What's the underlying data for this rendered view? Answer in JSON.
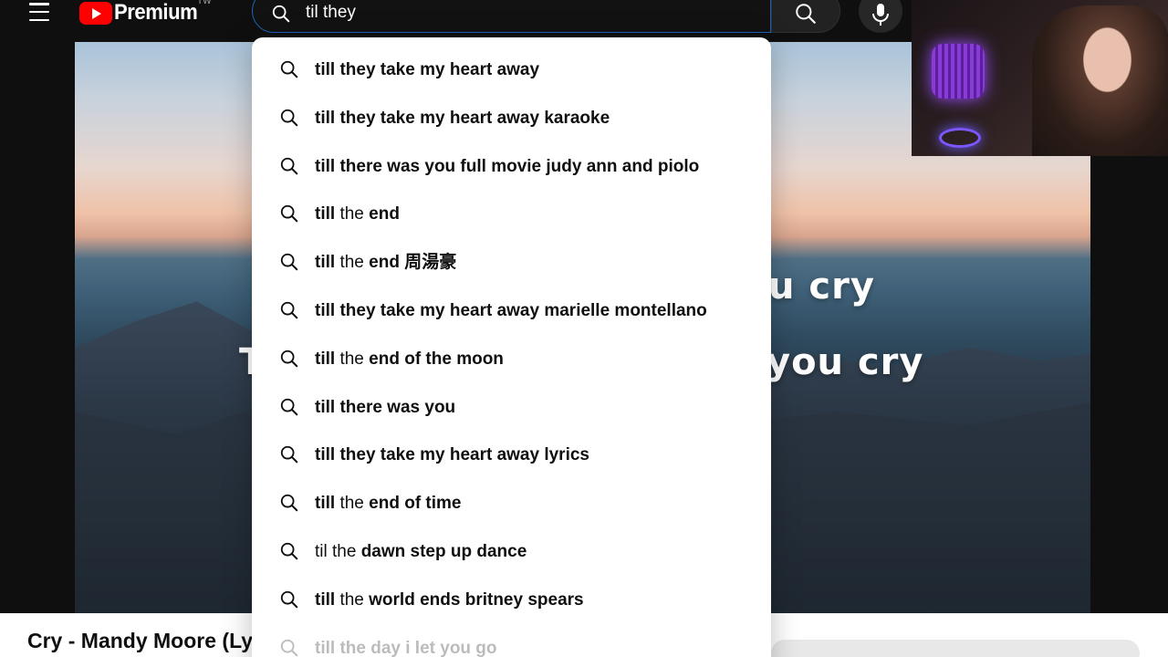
{
  "header": {
    "logo_text": "Premium",
    "country_code": "TW",
    "search_value": "til they"
  },
  "player": {
    "lyric_line_1": "u cry",
    "lyric_line_2": "you cry",
    "lyric_line_2_lead": "T"
  },
  "video": {
    "title": "Cry - Mandy Moore (Lyrics)"
  },
  "suggestions": [
    {
      "prefix": "",
      "rest": "till they take my heart away"
    },
    {
      "prefix": "",
      "rest": "till they take my heart away karaoke"
    },
    {
      "prefix": "",
      "rest": "till there was you full movie judy ann and piolo"
    },
    {
      "prefix": "till",
      "rest": " the end",
      "bold_first": true
    },
    {
      "prefix": "till",
      "rest": " the end 周湯豪",
      "bold_first": true
    },
    {
      "prefix": "",
      "rest": "till they take my heart away marielle montellano"
    },
    {
      "prefix": "till",
      "rest": " the end of the moon",
      "bold_first": true
    },
    {
      "prefix": "",
      "rest": "till there was you"
    },
    {
      "prefix": "",
      "rest": "till they take my heart away lyrics"
    },
    {
      "prefix": "till",
      "rest": " the end of time",
      "bold_first": true
    },
    {
      "prefix": "til the",
      "rest": " dawn step up dance"
    },
    {
      "prefix": "till",
      "rest": " the world ends britney spears",
      "bold_first": true
    },
    {
      "prefix": "",
      "rest": "till the day i let you go"
    }
  ],
  "icons": {
    "menu": "menu-icon",
    "search": "search-icon",
    "mic": "mic-icon",
    "logo": "youtube-logo-icon"
  },
  "colors": {
    "brand_red": "#ff0000",
    "search_focus_border": "#1c62b9",
    "dropdown_bg": "#ffffff"
  }
}
